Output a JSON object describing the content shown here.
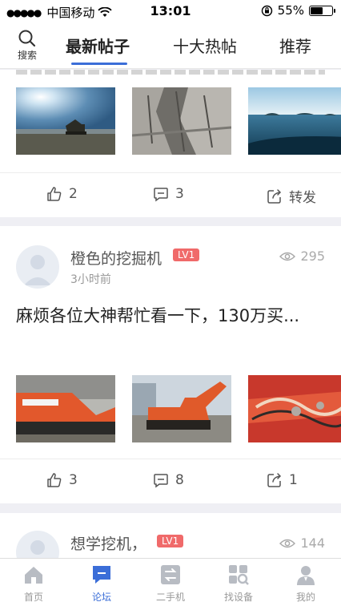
{
  "status_bar": {
    "carrier": "中国移动",
    "time": "13:01",
    "battery_percent": "55%",
    "battery_level": 0.55
  },
  "header": {
    "search_label": "搜索",
    "tabs": [
      {
        "label": "最新帖子",
        "active": true
      },
      {
        "label": "十大热帖",
        "active": false
      },
      {
        "label": "推荐",
        "active": false
      }
    ],
    "accent_color": "#3b6ed8"
  },
  "posts": [
    {
      "title_partial": "",
      "likes": "2",
      "comments": "3",
      "share_label": "转发",
      "photos": [
        "excavator-on-beach-photo",
        "rock-cliff-photo",
        "sea-islands-photo"
      ]
    },
    {
      "username": "橙色的挖掘机",
      "level": "LV1",
      "time_ago": "3小时前",
      "views": "295",
      "title": "麻烦各位大神帮忙看一下，130万买...",
      "likes": "3",
      "comments": "8",
      "shares": "1",
      "photos": [
        "orange-excavator-photo",
        "orange-excavator-side-photo",
        "excavator-parts-photo"
      ]
    },
    {
      "username": "想学挖机，",
      "level": "LV1",
      "views": "144"
    }
  ],
  "bottom_nav": [
    {
      "label": "首页",
      "icon": "home-icon",
      "active": false
    },
    {
      "label": "论坛",
      "icon": "forum-icon",
      "active": true
    },
    {
      "label": "二手机",
      "icon": "swap-icon",
      "active": false
    },
    {
      "label": "找设备",
      "icon": "find-equipment-icon",
      "active": false
    },
    {
      "label": "我的",
      "icon": "profile-icon",
      "active": false
    }
  ]
}
